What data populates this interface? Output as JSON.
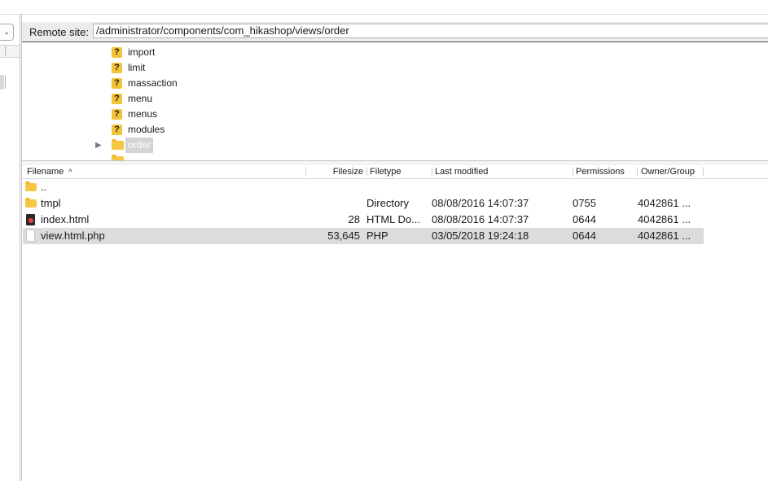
{
  "local_pane": {
    "dropdown_icon": "chevron-down-icon",
    "dropdown_glyph": "⌄"
  },
  "remote_site": {
    "label": "Remote site:",
    "path": "/administrator/components/com_hikashop/views/order"
  },
  "tree": {
    "items": [
      {
        "label": "import",
        "icon": "unknown-folder-icon"
      },
      {
        "label": "limit",
        "icon": "unknown-folder-icon"
      },
      {
        "label": "massaction",
        "icon": "unknown-folder-icon"
      },
      {
        "label": "menu",
        "icon": "unknown-folder-icon"
      },
      {
        "label": "menus",
        "icon": "unknown-folder-icon"
      },
      {
        "label": "modules",
        "icon": "unknown-folder-icon"
      }
    ],
    "selected": {
      "label": "order",
      "icon": "folder-icon",
      "expand_glyph": "▶"
    },
    "unknown_glyph": "?"
  },
  "file_list": {
    "columns": {
      "filename": "Filename",
      "filesize": "Filesize",
      "filetype": "Filetype",
      "last_modified": "Last modified",
      "permissions": "Permissions",
      "owner_group": "Owner/Group"
    },
    "sort_glyph": "^",
    "rows": [
      {
        "name": "..",
        "size": "",
        "type": "",
        "modified": "",
        "permissions": "",
        "owner": "",
        "icon": "folder-icon"
      },
      {
        "name": "tmpl",
        "size": "",
        "type": "Directory",
        "modified": "08/08/2016 14:07:37",
        "permissions": "0755",
        "owner": "4042861 ...",
        "icon": "folder-icon"
      },
      {
        "name": "index.html",
        "size": "28",
        "type": "HTML Do...",
        "modified": "08/08/2016 14:07:37",
        "permissions": "0644",
        "owner": "4042861 ...",
        "icon": "html-file-icon"
      },
      {
        "name": "view.html.php",
        "size": "53,645",
        "type": "PHP",
        "modified": "03/05/2018 19:24:18",
        "permissions": "0644",
        "owner": "4042861 ...",
        "icon": "document-icon",
        "selected": true
      }
    ]
  },
  "colors": {
    "folder": "#f6c644",
    "unknown_icon": "#f2c336",
    "selection": "#dcdcdc"
  }
}
